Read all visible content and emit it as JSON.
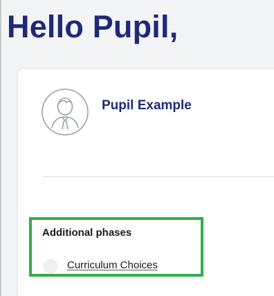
{
  "header": {
    "greeting": "Hello Pupil,"
  },
  "profile": {
    "name": "Pupil Example",
    "avatar_icon": "user-avatar-icon"
  },
  "additional_phases": {
    "heading": "Additional phases",
    "items": [
      {
        "label": "Curriculum Choices",
        "selected": false
      }
    ]
  },
  "colors": {
    "heading_navy": "#1e2a78",
    "highlight_green": "#2fae47"
  }
}
